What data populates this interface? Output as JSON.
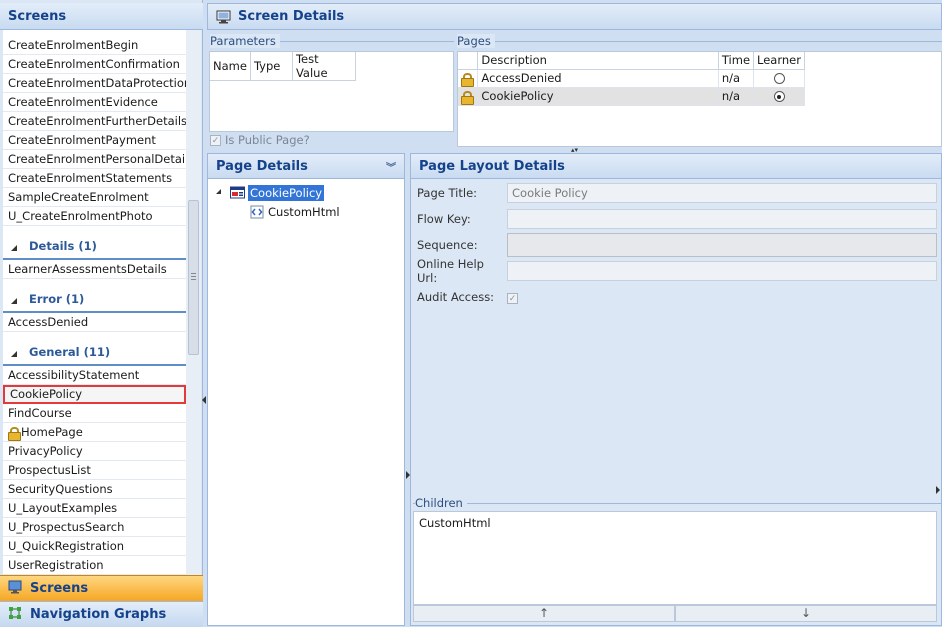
{
  "left": {
    "title": "Screens",
    "items_top": [
      "CreateEnrolmentBegin",
      "CreateEnrolmentConfirmation",
      "CreateEnrolmentDataProtection",
      "CreateEnrolmentEvidence",
      "CreateEnrolmentFurtherDetails",
      "CreateEnrolmentPayment",
      "CreateEnrolmentPersonalDetails",
      "CreateEnrolmentStatements",
      "SampleCreateEnrolment",
      "U_CreateEnrolmentPhoto"
    ],
    "group_details": "Details (1)",
    "items_details": [
      "LearnerAssessmentsDetails"
    ],
    "group_error": "Error (1)",
    "items_error": [
      "AccessDenied"
    ],
    "group_general": "General (11)",
    "items_general": [
      "AccessibilityStatement",
      "CookiePolicy",
      "FindCourse",
      "HomePage",
      "PrivacyPolicy",
      "ProspectusList",
      "SecurityQuestions",
      "U_LayoutExamples",
      "U_ProspectusSearch",
      "U_QuickRegistration",
      "UserRegistration"
    ],
    "nav_screens": "Screens",
    "nav_graphs": "Navigation Graphs"
  },
  "screen_details": {
    "title": "Screen Details",
    "parameters": {
      "legend": "Parameters",
      "columns": [
        "Name",
        "Type",
        "Test Value"
      ],
      "is_public_label": "Is Public Page?"
    },
    "pages": {
      "legend": "Pages",
      "columns": [
        "Description",
        "Time",
        "Learner"
      ],
      "rows": [
        {
          "description": "AccessDenied",
          "time": "n/a",
          "learner": false
        },
        {
          "description": "CookiePolicy",
          "time": "n/a",
          "learner": true
        }
      ]
    }
  },
  "page_details": {
    "title": "Page Details",
    "tree_root": "CookiePolicy",
    "tree_child": "CustomHtml"
  },
  "layout_details": {
    "title": "Page Layout Details",
    "page_title_label": "Page Title:",
    "page_title_value": "Cookie Policy",
    "flow_key_label": "Flow Key:",
    "sequence_label": "Sequence:",
    "help_url_label": "Online Help Url:",
    "audit_label": "Audit Access:",
    "children_legend": "Children",
    "children_items": [
      "CustomHtml"
    ]
  }
}
